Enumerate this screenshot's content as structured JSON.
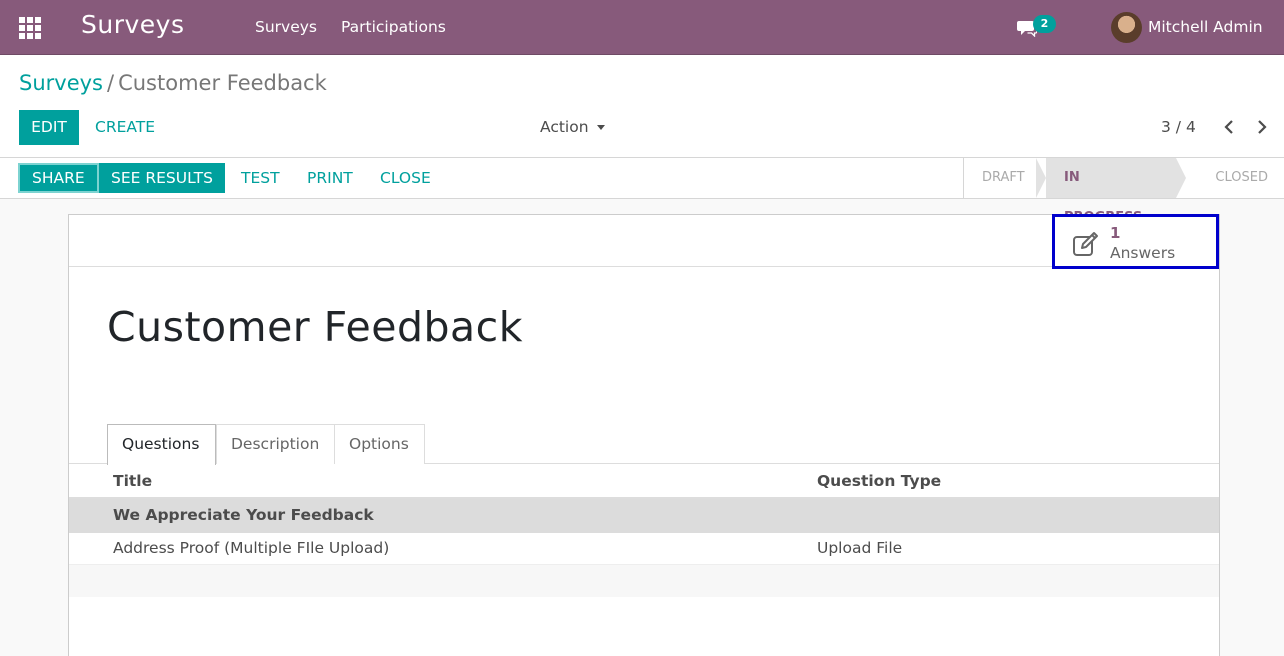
{
  "navbar": {
    "brand": "Surveys",
    "menu": [
      "Surveys",
      "Participations"
    ],
    "chat_count": "2",
    "user_name": "Mitchell Admin"
  },
  "breadcrumb": {
    "parent": "Surveys",
    "separator": "/",
    "current": "Customer Feedback"
  },
  "toolbar": {
    "edit_label": "EDIT",
    "create_label": "CREATE",
    "action_label": "Action",
    "pager": "3 / 4"
  },
  "statusbar": {
    "buttons": {
      "share": "SHARE",
      "see_results": "SEE RESULTS",
      "test": "TEST",
      "print": "PRINT",
      "close": "CLOSE"
    },
    "stages": [
      "DRAFT",
      "IN PROGRESS",
      "CLOSED"
    ],
    "active_stage": "IN PROGRESS"
  },
  "form": {
    "answers_count": "1",
    "answers_label": "Answers",
    "title": "Customer Feedback",
    "tabs": [
      "Questions",
      "Description",
      "Options"
    ],
    "active_tab": "Questions",
    "columns": [
      "Title",
      "Question Type"
    ],
    "section": "We Appreciate Your Feedback",
    "rows": [
      {
        "title": "Address Proof (Multiple FIle Upload)",
        "type": "Upload File"
      }
    ]
  },
  "colors": {
    "navbar": "#875a7b",
    "primary": "#00a09d",
    "highlight_box": "#0000cc"
  },
  "icons": [
    "apps-grid-icon",
    "chat-icon",
    "caret-down-icon",
    "chevron-left-icon",
    "chevron-right-icon",
    "edit-icon"
  ]
}
